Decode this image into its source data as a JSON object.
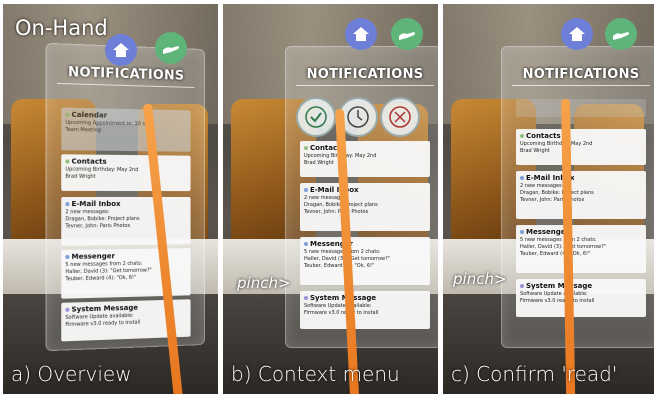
{
  "colors": {
    "home_button": "#6d7fd8",
    "hand_button": "#5fb579",
    "beam": "#e8751d"
  },
  "panels": [
    {
      "caption": "a) Overview",
      "label": "On-Hand",
      "header": "NOTIFICATIONS",
      "cards": [
        {
          "title": "Calendar",
          "lines": [
            "Upcoming Appointment in: 30 min",
            "Team Meeting"
          ],
          "dot": "#8fbf7f"
        },
        {
          "title": "Contacts",
          "lines": [
            "Upcoming Birthday: May 2nd",
            "Brad Wright"
          ],
          "dot": "#8fbf7f"
        },
        {
          "title": "E-Mail Inbox",
          "lines": [
            "2 new messages:",
            "Dragan, Bobike: Project plans",
            "Tevner, John: Paris Photos"
          ],
          "dot": "#7f9fd8"
        },
        {
          "title": "Messenger",
          "lines": [
            "5 new messages from 2 chats:",
            "Haller, David (3): \"Get tomorrow?\"",
            "Teuber, Edward (4): \"Ok, 6!\""
          ],
          "dot": "#7f9fd8"
        },
        {
          "title": "System Message",
          "lines": [
            "Software Update available:",
            "Firmware v3.0 ready to install"
          ],
          "dot": "#a090d8"
        }
      ]
    },
    {
      "caption": "b) Context menu",
      "pinch": "pinch>",
      "header": "NOTIFICATIONS",
      "cards": [
        {
          "title": "Contacts",
          "lines": [
            "Upcoming Birthday: May 2nd",
            "Brad Wright"
          ],
          "dot": "#8fbf7f"
        },
        {
          "title": "E-Mail Inbox",
          "lines": [
            "2 new messages:",
            "Dragan, Bobike: Project plans",
            "Tevner, John: Paris Photos"
          ],
          "dot": "#7f9fd8"
        },
        {
          "title": "Messenger",
          "lines": [
            "5 new messages from 2 chats:",
            "Haller, David (3): \"Get tomorrow?\"",
            "Teuber, Edward (4): \"Ok, 6!\""
          ],
          "dot": "#7f9fd8"
        },
        {
          "title": "System Message",
          "lines": [
            "Software Update available:",
            "Firmware v3.0 ready to install"
          ],
          "dot": "#a090d8"
        }
      ]
    },
    {
      "caption": "c) Confirm 'read'",
      "pinch": "pinch>",
      "header": "NOTIFICATIONS",
      "cards": [
        {
          "title": "Contacts",
          "lines": [
            "Upcoming Birthday: May 2nd",
            "Brad Wright"
          ],
          "dot": "#8fbf7f"
        },
        {
          "title": "E-Mail Inbox",
          "lines": [
            "2 new messages:",
            "Dragan, Bobike: Project plans",
            "Tevner, John: Paris Photos"
          ],
          "dot": "#7f9fd8"
        },
        {
          "title": "Messenger",
          "lines": [
            "5 new messages from 2 chats:",
            "Haller, David (3): \"Get tomorrow?\"",
            "Teuber, Edward (4): \"Ok, 6!\""
          ],
          "dot": "#7f9fd8"
        },
        {
          "title": "System Message",
          "lines": [
            "Software Update available:",
            "Firmware v3.0 ready to install"
          ],
          "dot": "#a090d8"
        }
      ]
    }
  ]
}
